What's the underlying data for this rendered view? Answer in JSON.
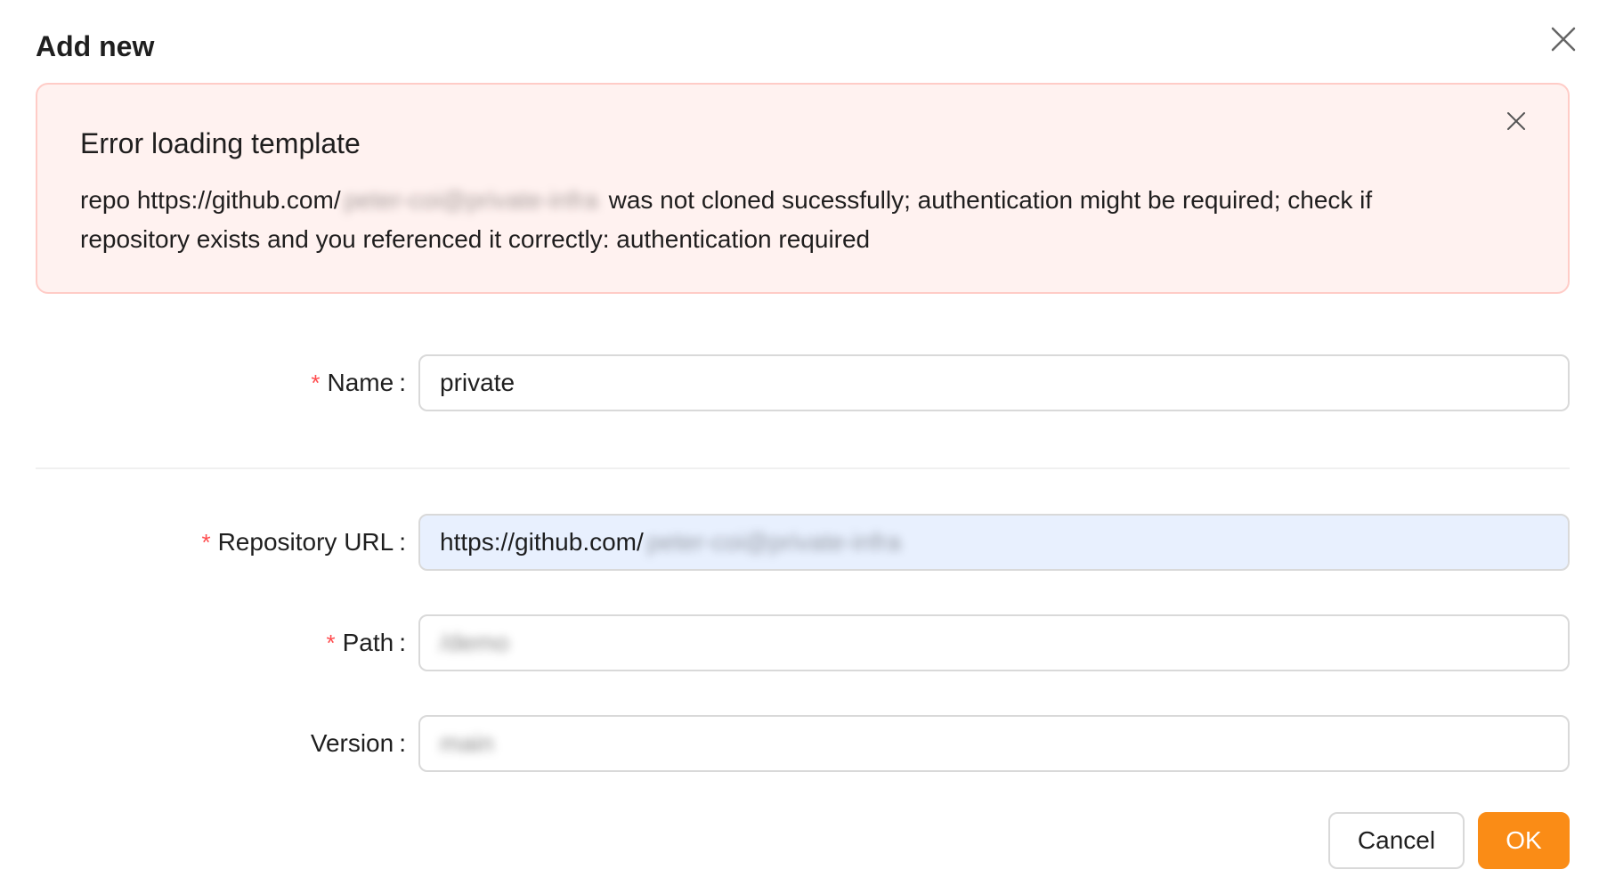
{
  "dialog": {
    "title": "Add new",
    "close_icon": "close-icon"
  },
  "alert": {
    "title": "Error loading template",
    "desc_prefix": "repo https://github.com/",
    "desc_redacted": "peter-coi@private-infra",
    "desc_suffix": "was not cloned sucessfully; authentication might be required; check if repository exists and you referenced it correctly: authentication required",
    "close_icon": "close-icon",
    "background_color": "#fff2f0",
    "border_color": "#ffccc7"
  },
  "form": {
    "name": {
      "label": "Name",
      "value": "private",
      "required": true
    },
    "repo_url": {
      "label": "Repository URL",
      "value_prefix": "https://github.com/",
      "value_redacted": "peter-coi@private-infra",
      "required": true
    },
    "path": {
      "label": "Path",
      "value_redacted": "/demo",
      "required": true
    },
    "version": {
      "label": "Version",
      "value_redacted": "main",
      "required": false
    },
    "colon": ":",
    "required_marker": "*"
  },
  "footer": {
    "cancel_label": "Cancel",
    "ok_label": "OK",
    "ok_color": "#fa8c16"
  }
}
